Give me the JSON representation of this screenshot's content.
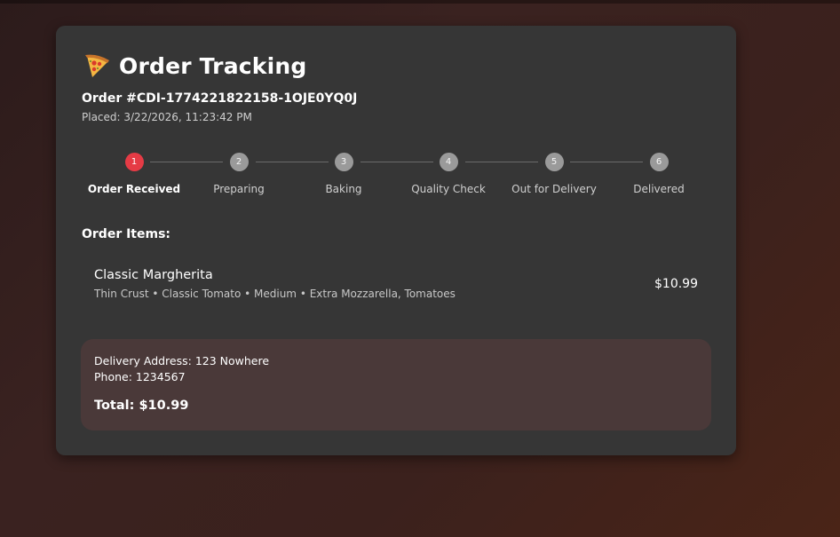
{
  "header": {
    "icon": "pizza-icon",
    "title": "Order Tracking"
  },
  "order": {
    "id": "Order #CDI-1774221822158-1OJE0YQ0J",
    "placed": "Placed: 3/22/2026, 11:23:42 PM"
  },
  "steps": [
    {
      "number": "1",
      "label": "Order Received",
      "active": true
    },
    {
      "number": "2",
      "label": "Preparing",
      "active": false
    },
    {
      "number": "3",
      "label": "Baking",
      "active": false
    },
    {
      "number": "4",
      "label": "Quality Check",
      "active": false
    },
    {
      "number": "5",
      "label": "Out for Delivery",
      "active": false
    },
    {
      "number": "6",
      "label": "Delivered",
      "active": false
    }
  ],
  "items_heading": "Order Items:",
  "items": [
    {
      "name": "Classic Margherita",
      "description": "Thin Crust • Classic Tomato • Medium • Extra Mozzarella, Tomatoes",
      "price": "$10.99"
    }
  ],
  "summary": {
    "address": "Delivery Address: 123 Nowhere",
    "phone": "Phone: 1234567",
    "total": "Total: $10.99"
  },
  "colors": {
    "accent": "#e53b45",
    "card": "#363636",
    "summary": "#4a3939",
    "inactive_step": "#9a9a9a"
  }
}
